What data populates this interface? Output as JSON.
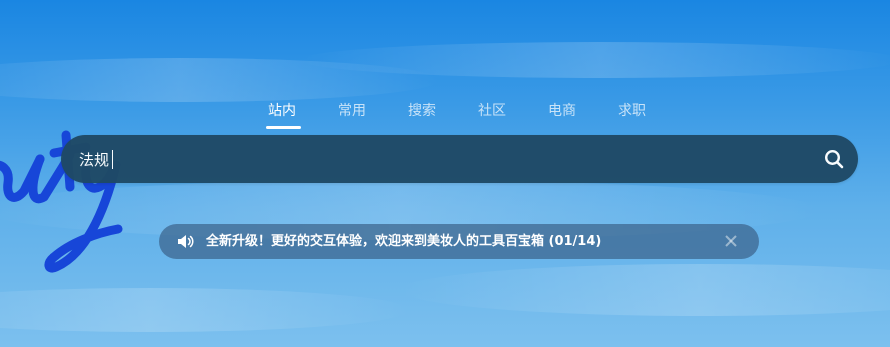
{
  "tabs": [
    {
      "label": "站内",
      "active": true
    },
    {
      "label": "常用",
      "active": false
    },
    {
      "label": "搜索",
      "active": false
    },
    {
      "label": "社区",
      "active": false
    },
    {
      "label": "电商",
      "active": false
    },
    {
      "label": "求职",
      "active": false
    }
  ],
  "search": {
    "value": "法规",
    "icon": "search-icon"
  },
  "notice": {
    "icon": "speaker-icon",
    "text": "全新升级！更好的交互体验，欢迎来到美妆人的工具百宝箱 (01/14)",
    "close_icon": "close-icon"
  },
  "colors": {
    "bg_top": "#1a86e2",
    "bg_bottom": "#7cc0ee",
    "search_bg": "#1f4a66",
    "script_blue": "#1746d8"
  }
}
